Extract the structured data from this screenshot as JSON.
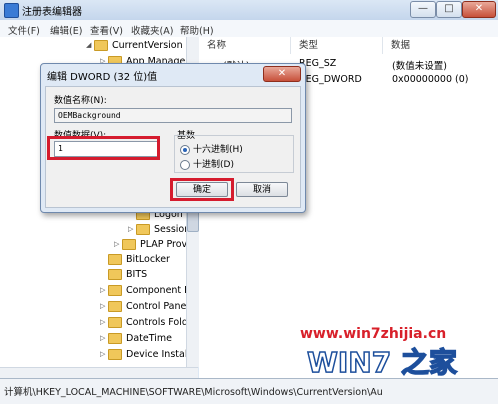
{
  "window": {
    "title": "注册表编辑器",
    "controls": {
      "minimize": "—",
      "maximize": "□",
      "close": "✕"
    }
  },
  "menu": [
    "文件(F)",
    "编辑(E)",
    "查看(V)",
    "收藏夹(A)",
    "帮助(H)"
  ],
  "tree": {
    "items": [
      {
        "label": "CurrentVersion",
        "arrow": "◢"
      },
      {
        "label": "App Manage",
        "arrow": "▷"
      },
      {
        "label": "Logon",
        "arrow": ""
      },
      {
        "label": "Session",
        "arrow": "▷"
      },
      {
        "label": "PLAP Prov",
        "arrow": "▷"
      },
      {
        "label": "BitLocker",
        "arrow": ""
      },
      {
        "label": "BITS",
        "arrow": ""
      },
      {
        "label": "Component E",
        "arrow": "▷"
      },
      {
        "label": "Control Panel",
        "arrow": "▷"
      },
      {
        "label": "Controls Fold",
        "arrow": "▷"
      },
      {
        "label": "DateTime",
        "arrow": "▷"
      },
      {
        "label": "Device Install",
        "arrow": "▷"
      }
    ]
  },
  "list": {
    "columns": [
      "名称",
      "类型",
      "数据"
    ],
    "rows": [
      {
        "name": "(默认)",
        "type": "REG_SZ",
        "data": "(数值未设置)"
      },
      {
        "name": "",
        "type": "REG_DWORD",
        "data": "0x00000000 (0)"
      }
    ]
  },
  "status": {
    "path": "计算机\\HKEY_LOCAL_MACHINE\\SOFTWARE\\Microsoft\\Windows\\CurrentVersion\\Au"
  },
  "dialog": {
    "title": "编辑 DWORD (32 位)值",
    "close": "✕",
    "value_name_label": "数值名称(N):",
    "value_name": "OEMBackground",
    "value_data_label": "数值数据(V):",
    "value_data": "1",
    "base_label": "基数",
    "base_hex": "十六进制(H)",
    "base_dec": "十进制(D)",
    "base_selected": "十六进制(H)",
    "ok": "确定",
    "cancel": "取消"
  },
  "watermark": {
    "url": "www.win7zhijia.cn",
    "logo_text": "WIN7 之家"
  },
  "colors": {
    "highlight": "#d51c2e",
    "accent": "#3a7bd5",
    "watermark": "#d8202a"
  },
  "icons": [
    "regedit-icon",
    "folder-icon",
    "expand-arrow-icon",
    "radio-icon",
    "close-icon"
  ]
}
